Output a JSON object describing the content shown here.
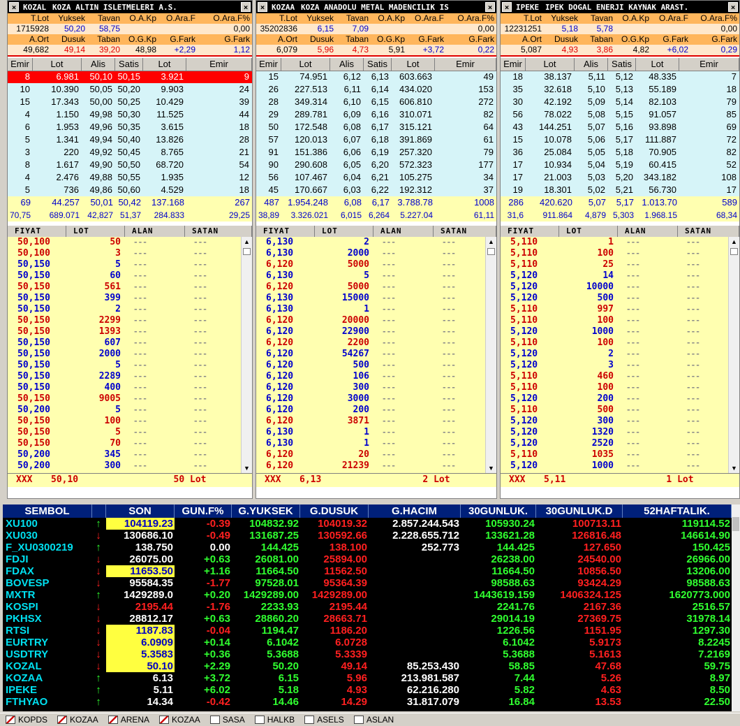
{
  "panels": [
    {
      "symbol": "KOZAL",
      "name": "KOZA ALTIN ISLETMELERI A.S.",
      "sum_head1": [
        "T.Lot",
        "Yuksek",
        "Tavan",
        "O.A.Kp",
        "O.Ara.F",
        "O.Ara.F%"
      ],
      "sum_val1": [
        "1715928",
        "50,20",
        "58,75",
        "",
        "",
        "0,00"
      ],
      "sum_head2": [
        "A.Ort",
        "Dusuk",
        "Taban",
        "O.G.Kp",
        "G.Fark",
        "G.Fark"
      ],
      "sum_val2": [
        "49,682",
        "49,14",
        "39,20",
        "48,98",
        "+2,29",
        "1,12"
      ],
      "ob_head": [
        "Emir",
        "Lot",
        "Alis",
        "Satis",
        "Lot",
        "Emir"
      ],
      "ob_rows": [
        [
          "8",
          "6.981",
          "50,10",
          "50,15",
          "3.921",
          "9"
        ],
        [
          "10",
          "10.390",
          "50,05",
          "50,20",
          "9.903",
          "24"
        ],
        [
          "15",
          "17.343",
          "50,00",
          "50,25",
          "10.429",
          "39"
        ],
        [
          "4",
          "1.150",
          "49,98",
          "50,30",
          "11.525",
          "44"
        ],
        [
          "6",
          "1.953",
          "49,96",
          "50,35",
          "3.615",
          "18"
        ],
        [
          "5",
          "1.341",
          "49,94",
          "50,40",
          "13.826",
          "28"
        ],
        [
          "3",
          "220",
          "49,92",
          "50,45",
          "8.765",
          "21"
        ],
        [
          "8",
          "1.617",
          "49,90",
          "50,50",
          "68.720",
          "54"
        ],
        [
          "4",
          "2.476",
          "49,88",
          "50,55",
          "1.935",
          "12"
        ],
        [
          "5",
          "736",
          "49,86",
          "50,60",
          "4.529",
          "18"
        ]
      ],
      "tot1": [
        "69",
        "44.257",
        "50,01",
        "50,42",
        "137.168",
        "267"
      ],
      "tot2": [
        "70,75",
        "689.071",
        "42,827",
        "51,37",
        "284.833",
        "29,25"
      ],
      "tr_head": [
        "FIYAT",
        "LOT",
        "ALAN",
        "SATAN"
      ],
      "trades": [
        [
          "50,100",
          "50",
          "r"
        ],
        [
          "50,100",
          "3",
          "r"
        ],
        [
          "50,150",
          "5",
          "b"
        ],
        [
          "50,150",
          "60",
          "b"
        ],
        [
          "50,150",
          "561",
          "r"
        ],
        [
          "50,150",
          "399",
          "b"
        ],
        [
          "50,150",
          "2",
          "b"
        ],
        [
          "50,150",
          "2299",
          "r"
        ],
        [
          "50,150",
          "1393",
          "r"
        ],
        [
          "50,150",
          "607",
          "b"
        ],
        [
          "50,150",
          "2000",
          "b"
        ],
        [
          "50,150",
          "5",
          "b"
        ],
        [
          "50,150",
          "2289",
          "b"
        ],
        [
          "50,150",
          "400",
          "b"
        ],
        [
          "50,150",
          "9005",
          "r"
        ],
        [
          "50,200",
          "5",
          "b"
        ],
        [
          "50,150",
          "100",
          "r"
        ],
        [
          "50,150",
          "5",
          "r"
        ],
        [
          "50,150",
          "70",
          "r"
        ],
        [
          "50,200",
          "345",
          "b"
        ],
        [
          "50,200",
          "300",
          "b"
        ]
      ],
      "dash": "---",
      "foot": [
        "XXX",
        "50,10",
        "50 Lot"
      ]
    },
    {
      "symbol": "KOZAA",
      "name": "KOZA ANADOLU METAL MADENCILIK IS",
      "sum_head1": [
        "T.Lot",
        "Yuksek",
        "Tavan",
        "O.A.Kp",
        "O.Ara.F",
        "O.Ara.F%"
      ],
      "sum_val1": [
        "35202836",
        "6,15",
        "7,09",
        "",
        "",
        "0,00"
      ],
      "sum_head2": [
        "A.Ort",
        "Dusuk",
        "Taban",
        "O.G.Kp",
        "G.Fark",
        "G.Fark"
      ],
      "sum_val2": [
        "6,079",
        "5,96",
        "4,73",
        "5,91",
        "+3,72",
        "0,22"
      ],
      "ob_head": [
        "Emir",
        "Lot",
        "Alis",
        "Satis",
        "Lot",
        "Emir"
      ],
      "ob_rows": [
        [
          "15",
          "74.951",
          "6,12",
          "6,13",
          "603.663",
          "49"
        ],
        [
          "26",
          "227.513",
          "6,11",
          "6,14",
          "434.020",
          "153"
        ],
        [
          "28",
          "349.314",
          "6,10",
          "6,15",
          "606.810",
          "272"
        ],
        [
          "29",
          "289.781",
          "6,09",
          "6,16",
          "310.071",
          "82"
        ],
        [
          "50",
          "172.548",
          "6,08",
          "6,17",
          "315.121",
          "64"
        ],
        [
          "57",
          "120.013",
          "6,07",
          "6,18",
          "391.869",
          "61"
        ],
        [
          "91",
          "151.386",
          "6,06",
          "6,19",
          "257.320",
          "79"
        ],
        [
          "90",
          "290.608",
          "6,05",
          "6,20",
          "572.323",
          "177"
        ],
        [
          "56",
          "107.467",
          "6,04",
          "6,21",
          "105.275",
          "34"
        ],
        [
          "45",
          "170.667",
          "6,03",
          "6,22",
          "192.312",
          "37"
        ]
      ],
      "tot1": [
        "487",
        "1.954.248",
        "6,08",
        "6,17",
        "3.788.78",
        "1008"
      ],
      "tot2": [
        "38,89",
        "3.326.021",
        "6,015",
        "6,264",
        "5.227.04",
        "61,11"
      ],
      "tr_head": [
        "FIYAT",
        "LOT",
        "ALAN",
        "SATAN"
      ],
      "trades": [
        [
          "6,130",
          "2",
          "b"
        ],
        [
          "6,130",
          "2000",
          "b"
        ],
        [
          "6,120",
          "5000",
          "r"
        ],
        [
          "6,130",
          "5",
          "b"
        ],
        [
          "6,120",
          "5000",
          "r"
        ],
        [
          "6,130",
          "15000",
          "b"
        ],
        [
          "6,130",
          "1",
          "b"
        ],
        [
          "6,120",
          "20000",
          "r"
        ],
        [
          "6,120",
          "22900",
          "b"
        ],
        [
          "6,120",
          "2200",
          "r"
        ],
        [
          "6,120",
          "54267",
          "b"
        ],
        [
          "6,120",
          "500",
          "b"
        ],
        [
          "6,120",
          "106",
          "b"
        ],
        [
          "6,120",
          "300",
          "b"
        ],
        [
          "6,120",
          "3000",
          "b"
        ],
        [
          "6,120",
          "200",
          "b"
        ],
        [
          "6,120",
          "3871",
          "r"
        ],
        [
          "6,130",
          "1",
          "b"
        ],
        [
          "6,130",
          "1",
          "b"
        ],
        [
          "6,120",
          "20",
          "r"
        ],
        [
          "6,120",
          "21239",
          "r"
        ]
      ],
      "dash": "---",
      "foot": [
        "XXX",
        "6,13",
        "2 Lot"
      ]
    },
    {
      "symbol": "IPEKE",
      "name": "IPEK DOGAL ENERJI KAYNAK ARAST.",
      "sum_head1": [
        "T.Lot",
        "Yuksek",
        "Tavan",
        "O.A.Kp",
        "O.Ara.F",
        "O.Ara.F%"
      ],
      "sum_val1": [
        "12231251",
        "5,18",
        "5,78",
        "",
        "",
        "0,00"
      ],
      "sum_head2": [
        "A.Ort",
        "Dusuk",
        "Taban",
        "O.G.Kp",
        "G.Fark",
        "G.Fark"
      ],
      "sum_val2": [
        "5,087",
        "4,93",
        "3,86",
        "4,82",
        "+6,02",
        "0,29"
      ],
      "ob_head": [
        "Emir",
        "Lot",
        "Alis",
        "Satis",
        "Lot",
        "Emir"
      ],
      "ob_rows": [
        [
          "18",
          "38.137",
          "5,11",
          "5,12",
          "48.335",
          "7"
        ],
        [
          "35",
          "32.618",
          "5,10",
          "5,13",
          "55.189",
          "18"
        ],
        [
          "30",
          "42.192",
          "5,09",
          "5,14",
          "82.103",
          "79"
        ],
        [
          "56",
          "78.022",
          "5,08",
          "5,15",
          "91.057",
          "85"
        ],
        [
          "43",
          "144.251",
          "5,07",
          "5,16",
          "93.898",
          "69"
        ],
        [
          "15",
          "10.078",
          "5,06",
          "5,17",
          "111.887",
          "72"
        ],
        [
          "36",
          "25.084",
          "5,05",
          "5,18",
          "70.905",
          "82"
        ],
        [
          "17",
          "10.934",
          "5,04",
          "5,19",
          "60.415",
          "52"
        ],
        [
          "17",
          "21.003",
          "5,03",
          "5,20",
          "343.182",
          "108"
        ],
        [
          "19",
          "18.301",
          "5,02",
          "5,21",
          "56.730",
          "17"
        ]
      ],
      "tot1": [
        "286",
        "420.620",
        "5,07",
        "5,17",
        "1.013.70",
        "589"
      ],
      "tot2": [
        "31,6",
        "911.864",
        "4,879",
        "5,303",
        "1.968.15",
        "68,34"
      ],
      "tr_head": [
        "FIYAT",
        "LOT",
        "ALAN",
        "SATAN"
      ],
      "trades": [
        [
          "5,110",
          "1",
          "r"
        ],
        [
          "5,110",
          "100",
          "r"
        ],
        [
          "5,110",
          "25",
          "r"
        ],
        [
          "5,120",
          "14",
          "b"
        ],
        [
          "5,120",
          "10000",
          "b"
        ],
        [
          "5,120",
          "500",
          "b"
        ],
        [
          "5,110",
          "997",
          "r"
        ],
        [
          "5,110",
          "100",
          "r"
        ],
        [
          "5,120",
          "1000",
          "b"
        ],
        [
          "5,110",
          "100",
          "r"
        ],
        [
          "5,120",
          "2",
          "b"
        ],
        [
          "5,120",
          "3",
          "b"
        ],
        [
          "5,110",
          "460",
          "r"
        ],
        [
          "5,110",
          "100",
          "r"
        ],
        [
          "5,120",
          "200",
          "b"
        ],
        [
          "5,110",
          "500",
          "r"
        ],
        [
          "5,120",
          "300",
          "b"
        ],
        [
          "5,120",
          "1320",
          "b"
        ],
        [
          "5,120",
          "2520",
          "b"
        ],
        [
          "5,110",
          "1035",
          "r"
        ],
        [
          "5,120",
          "1000",
          "b"
        ]
      ],
      "dash": "---",
      "foot": [
        "XXX",
        "5,11",
        "1 Lot"
      ]
    }
  ],
  "market": {
    "headers": [
      "SEMBOL",
      "",
      "SON",
      "GUN.F%",
      "G.YUKSEK",
      "G.DUSUK",
      "G.HACIM",
      "30GUNLUK.",
      "30GUNLUK.D",
      "52HAFTALIK."
    ],
    "rows": [
      {
        "sym": "XU100",
        "dir": "up",
        "son": "104119.23",
        "hl": "yl",
        "f": "-0.39",
        "fc": "rr",
        "hi": "104832.92",
        "hic": "g",
        "lo": "104019.32",
        "loc": "rr",
        "vol": "2.857.244.543",
        "h30": "105930.24",
        "l30": "100713.11",
        "w52": "119114.52"
      },
      {
        "sym": "XU030",
        "dir": "dn",
        "son": "130686.10",
        "hl": "",
        "f": "-0.49",
        "fc": "rr",
        "hi": "131687.25",
        "hic": "g",
        "lo": "130592.66",
        "loc": "rr",
        "vol": "2.228.655.712",
        "h30": "133621.28",
        "l30": "126816.48",
        "w52": "146614.90"
      },
      {
        "sym": "F_XU0300219",
        "dir": "up",
        "son": "138.750",
        "hl": "",
        "f": "0.00",
        "fc": "w",
        "hi": "144.425",
        "hic": "g",
        "lo": "138.100",
        "loc": "rr",
        "vol": "252.773",
        "h30": "144.425",
        "l30": "127.650",
        "w52": "150.425"
      },
      {
        "sym": "FDJI",
        "dir": "dn",
        "son": "26075.00",
        "hl": "",
        "f": "+0.63",
        "fc": "g",
        "hi": "26081.00",
        "hic": "g",
        "lo": "25894.00",
        "loc": "rr",
        "vol": "",
        "h30": "26238.00",
        "l30": "24540.00",
        "w52": "26966.00"
      },
      {
        "sym": "FDAX",
        "dir": "dn",
        "son": "11653.50",
        "hl": "yl",
        "f": "+1.16",
        "fc": "g",
        "hi": "11664.50",
        "hic": "g",
        "lo": "11562.50",
        "loc": "rr",
        "vol": "",
        "h30": "11664.50",
        "l30": "10856.50",
        "w52": "13206.00"
      },
      {
        "sym": "BOVESP",
        "dir": "dn",
        "son": "95584.35",
        "hl": "",
        "f": "-1.77",
        "fc": "rr",
        "hi": "97528.01",
        "hic": "g",
        "lo": "95364.39",
        "loc": "rr",
        "vol": "",
        "h30": "98588.63",
        "l30": "93424.29",
        "w52": "98588.63"
      },
      {
        "sym": "MXTR",
        "dir": "up",
        "son": "1429289.0",
        "hl": "",
        "f": "+0.20",
        "fc": "g",
        "hi": "1429289.00",
        "hic": "g",
        "lo": "1429289.00",
        "loc": "rr",
        "vol": "",
        "h30": "1443619.159",
        "l30": "1406324.125",
        "w52": "1620773.000"
      },
      {
        "sym": "KOSPI",
        "dir": "dn",
        "son": "2195.44",
        "hl": "rd",
        "f": "-1.76",
        "fc": "rr",
        "hi": "2233.93",
        "hic": "g",
        "lo": "2195.44",
        "loc": "rr",
        "vol": "",
        "h30": "2241.76",
        "l30": "2167.36",
        "w52": "2516.57"
      },
      {
        "sym": "PKHSX",
        "dir": "dn",
        "son": "28812.17",
        "hl": "",
        "f": "+0.63",
        "fc": "g",
        "hi": "28860.20",
        "hic": "g",
        "lo": "28663.71",
        "loc": "rr",
        "vol": "",
        "h30": "29014.19",
        "l30": "27369.75",
        "w52": "31978.14"
      },
      {
        "sym": "RTSI",
        "dir": "dn",
        "son": "1187.83",
        "hl": "yl",
        "f": "-0.04",
        "fc": "rr",
        "hi": "1194.47",
        "hic": "g",
        "lo": "1186.20",
        "loc": "rr",
        "vol": "",
        "h30": "1226.56",
        "l30": "1151.95",
        "w52": "1297.30"
      },
      {
        "sym": "EURTRY",
        "dir": "dn",
        "son": "6.0909",
        "hl": "yl",
        "f": "+0.14",
        "fc": "g",
        "hi": "6.1042",
        "hic": "g",
        "lo": "6.0728",
        "loc": "rr",
        "vol": "",
        "h30": "6.1042",
        "l30": "5.9173",
        "w52": "8.2245"
      },
      {
        "sym": "USDTRY",
        "dir": "dn",
        "son": "5.3583",
        "hl": "yl",
        "f": "+0.36",
        "fc": "g",
        "hi": "5.3688",
        "hic": "g",
        "lo": "5.3339",
        "loc": "rr",
        "vol": "",
        "h30": "5.3688",
        "l30": "5.1613",
        "w52": "7.2169"
      },
      {
        "sym": "KOZAL",
        "dir": "dn",
        "son": "50.10",
        "hl": "yl",
        "f": "+2.29",
        "fc": "g",
        "hi": "50.20",
        "hic": "g",
        "lo": "49.14",
        "loc": "rr",
        "vol": "85.253.430",
        "h30": "58.85",
        "l30": "47.68",
        "w52": "59.75"
      },
      {
        "sym": "KOZAA",
        "dir": "up",
        "son": "6.13",
        "hl": "",
        "f": "+3.72",
        "fc": "g",
        "hi": "6.15",
        "hic": "g",
        "lo": "5.96",
        "loc": "rr",
        "vol": "213.981.587",
        "h30": "7.44",
        "l30": "5.26",
        "w52": "8.97"
      },
      {
        "sym": "IPEKE",
        "dir": "up",
        "son": "5.11",
        "hl": "",
        "f": "+6.02",
        "fc": "g",
        "hi": "5.18",
        "hic": "g",
        "lo": "4.93",
        "loc": "rr",
        "vol": "62.216.280",
        "h30": "5.82",
        "l30": "4.63",
        "w52": "8.50"
      },
      {
        "sym": "FTHYAO",
        "dir": "up",
        "son": "14.34",
        "hl": "",
        "f": "-0.42",
        "fc": "rr",
        "hi": "14.46",
        "hic": "g",
        "lo": "14.29",
        "loc": "rr",
        "vol": "31.817.079",
        "h30": "16.84",
        "l30": "13.53",
        "w52": "22.50"
      }
    ]
  },
  "tabs": [
    {
      "label": "KOPDS",
      "icon": "chart-icon"
    },
    {
      "label": "KOZAA",
      "icon": "chart-icon"
    },
    {
      "label": "ARENA",
      "icon": "chart-icon"
    },
    {
      "label": "KOZAA",
      "icon": "chart-icon"
    },
    {
      "label": "SASA",
      "icon": "table-icon"
    },
    {
      "label": "HALKB",
      "icon": "table-icon"
    },
    {
      "label": "ASELS",
      "icon": "table-icon"
    },
    {
      "label": "ASLAN",
      "icon": "table-icon"
    }
  ],
  "arrows": {
    "up": "↑",
    "dn": "↓"
  },
  "close_glyph": "×"
}
